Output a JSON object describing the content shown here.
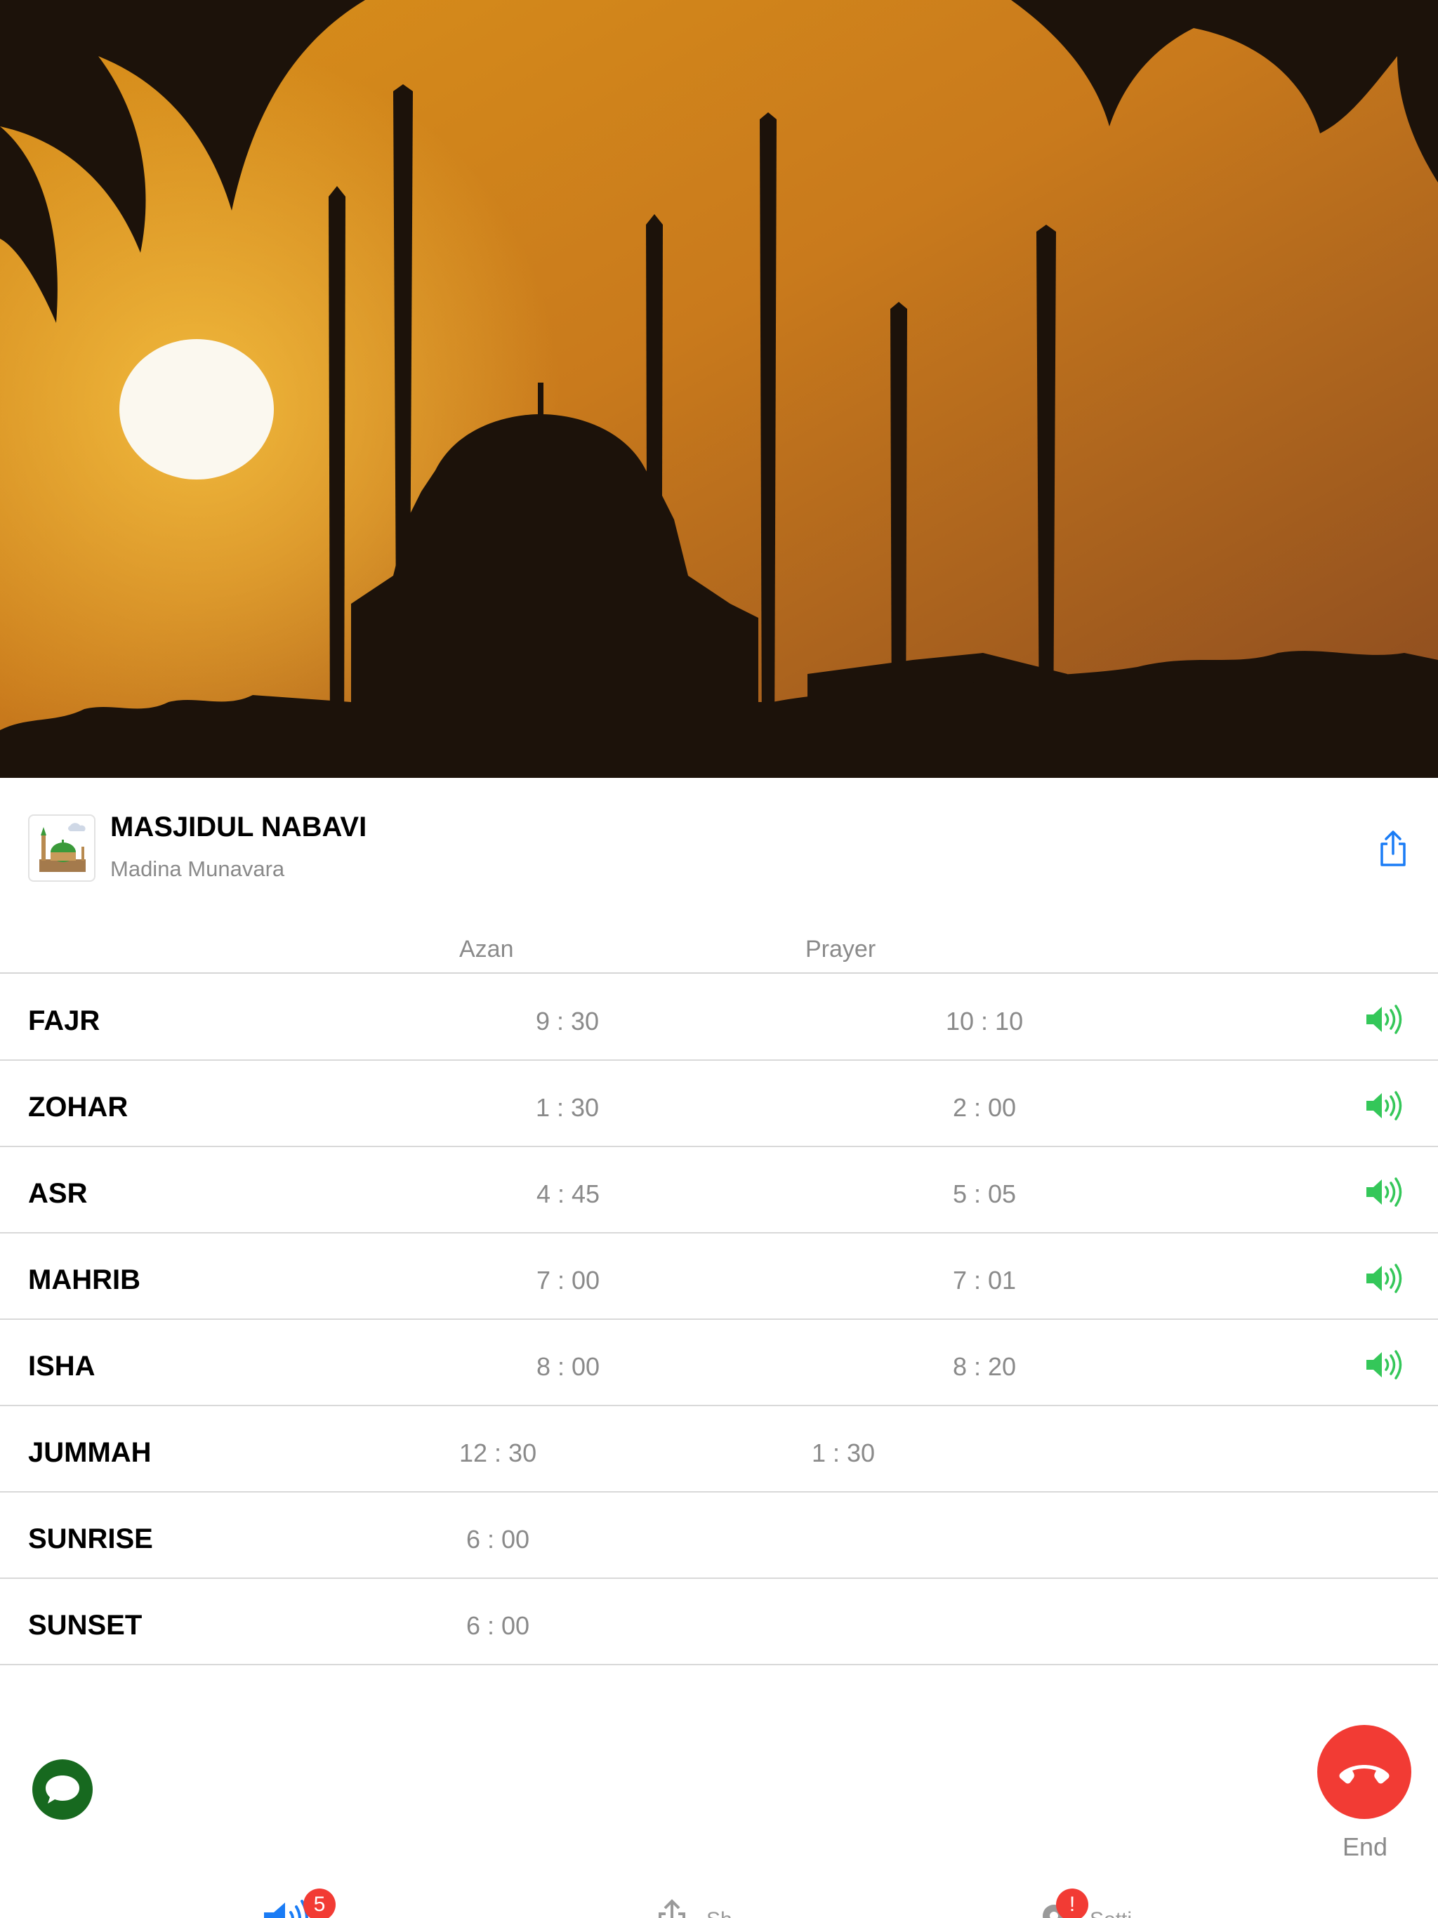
{
  "mosque": {
    "name": "MASJIDUL NABAVI",
    "location": "Madina Munavara"
  },
  "columns": {
    "azan": "Azan",
    "prayer": "Prayer"
  },
  "prayers": [
    {
      "name": "FAJR",
      "azan": "9 : 30",
      "prayer": "10 : 10",
      "alert": true
    },
    {
      "name": "ZOHAR",
      "azan": "1 : 30",
      "prayer": "2 : 00",
      "alert": true
    },
    {
      "name": "ASR",
      "azan": "4 : 45",
      "prayer": "5 : 05",
      "alert": true
    },
    {
      "name": "MAHRIB",
      "azan": "7 : 00",
      "prayer": "7 : 01",
      "alert": true
    },
    {
      "name": "ISHA",
      "azan": "8 : 00",
      "prayer": "8 : 20",
      "alert": true
    },
    {
      "name": "JUMMAH",
      "azan": "12 : 30",
      "prayer": "1 : 30",
      "alert": false
    },
    {
      "name": "SUNRISE",
      "azan": "6 : 00",
      "alert": false
    },
    {
      "name": "SUNSET",
      "azan": "6 : 00",
      "alert": false
    }
  ],
  "call": {
    "end_label": "End"
  },
  "tabs": [
    {
      "icon": "speaker-icon",
      "label": "",
      "badge": "5",
      "active": true
    },
    {
      "icon": "share-icon",
      "label": "Sh",
      "badge": ""
    },
    {
      "icon": "gear-icon",
      "label": "Setti",
      "badge": "!"
    }
  ],
  "colors": {
    "accent": "#1a7cf5",
    "speaker": "#34c759",
    "end_call": "#f23b34",
    "chat": "#17691f",
    "muted_text": "#8a8a8a"
  }
}
